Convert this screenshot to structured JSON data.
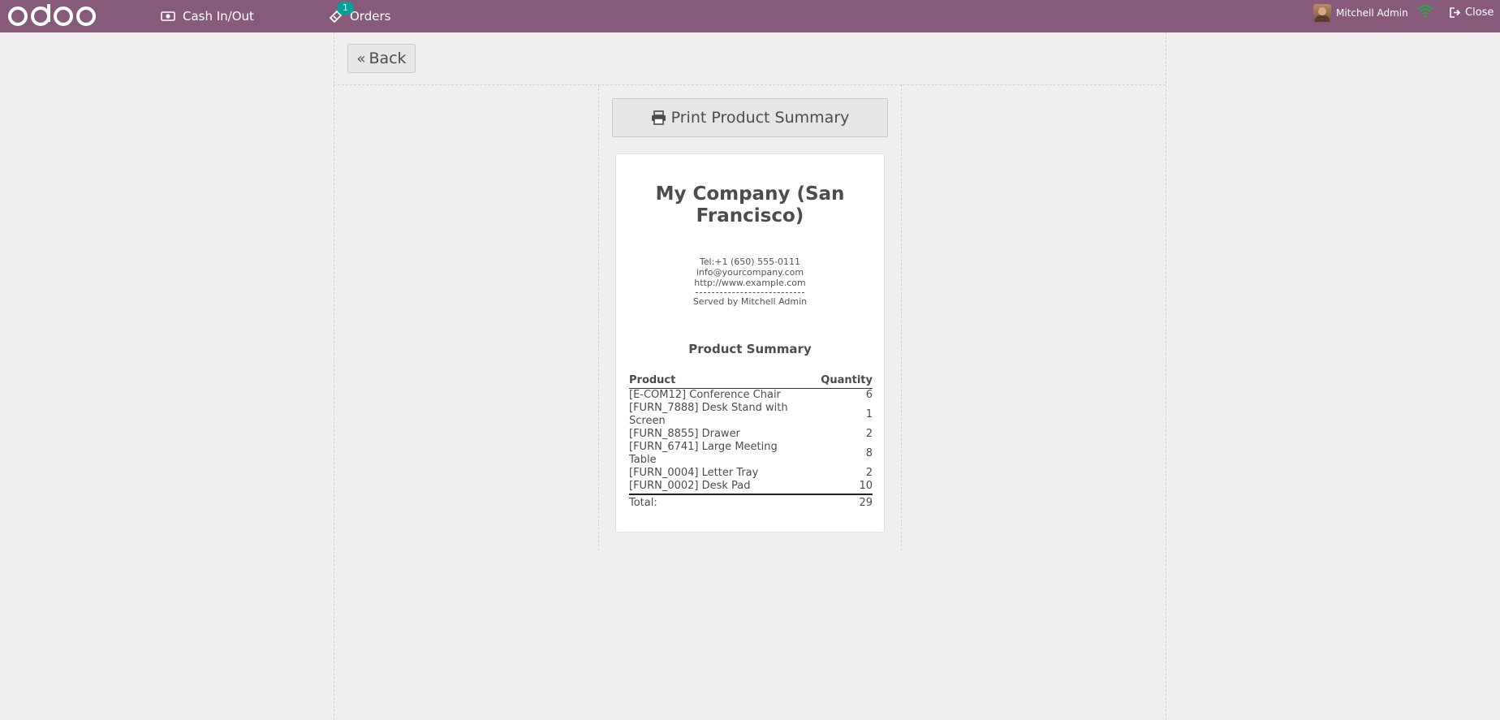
{
  "header": {
    "brand": "odoo",
    "cash_label": "Cash In/Out",
    "orders_label": "Orders",
    "orders_badge": "1",
    "user_name": "Mitchell Admin",
    "close_label": "Close"
  },
  "actions": {
    "back_label": "Back",
    "print_label": "Print Product Summary"
  },
  "receipt": {
    "company": "My Company (San Francisco)",
    "tel": "Tel:+1 (650) 555-0111",
    "email": "info@yourcompany.com",
    "website": "http://www.example.com",
    "served_by": "Served by Mitchell Admin",
    "summary_title": "Product Summary",
    "col_product": "Product",
    "col_quantity": "Quantity",
    "rows": [
      {
        "product": "[E-COM12] Conference Chair",
        "qty": "6"
      },
      {
        "product": "[FURN_7888] Desk Stand with Screen",
        "qty": "1"
      },
      {
        "product": "[FURN_8855] Drawer",
        "qty": "2"
      },
      {
        "product": "[FURN_6741] Large Meeting Table",
        "qty": "8"
      },
      {
        "product": "[FURN_0004] Letter Tray",
        "qty": "2"
      },
      {
        "product": "[FURN_0002] Desk Pad",
        "qty": "10"
      }
    ],
    "total_label": "Total:",
    "total_value": "29"
  },
  "colors": {
    "topbar": "#875a7b",
    "badge": "#00a09d",
    "background": "#f0eeee"
  }
}
